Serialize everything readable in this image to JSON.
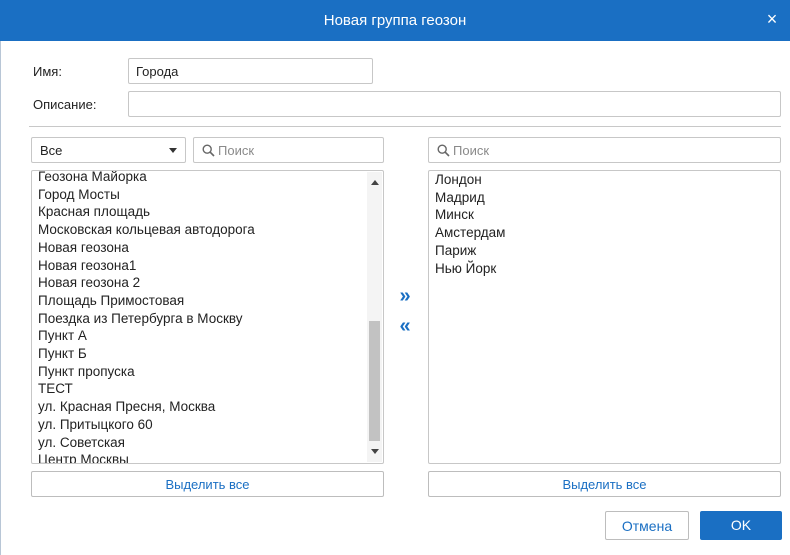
{
  "dialog": {
    "title": "Новая группа геозон",
    "close_label": "×",
    "colors": {
      "titlebar": "#1a6fc3",
      "accent": "#1a6fc3"
    }
  },
  "form": {
    "name_label": "Имя:",
    "name_value": "Города",
    "description_label": "Описание:",
    "description_value": ""
  },
  "left_panel": {
    "filter_selected": "Все",
    "search_placeholder": "Поиск",
    "items": [
      "Геозона Майорка",
      "Город Мосты",
      "Красная площадь",
      "Московская кольцевая автодорога",
      "Новая геозона",
      "Новая геозона1",
      "Новая геозона 2",
      "Площадь Примостовая",
      "Поездка из Петербурга в Москву",
      "Пункт А",
      "Пункт Б",
      "Пункт пропуска",
      "ТЕСТ",
      "ул. Красная Пресня, Москва",
      "ул. Притыцкого 60",
      "ул. Советская",
      "Центр Москвы"
    ],
    "select_all_label": "Выделить все"
  },
  "move_controls": {
    "add_label": "»",
    "remove_label": "«"
  },
  "right_panel": {
    "search_placeholder": "Поиск",
    "items": [
      "Лондон",
      "Мадрид",
      "Минск",
      "Амстердам",
      "Париж",
      "Нью Йорк"
    ],
    "select_all_label": "Выделить все"
  },
  "footer": {
    "cancel_label": "Отмена",
    "ok_label": "OK"
  }
}
